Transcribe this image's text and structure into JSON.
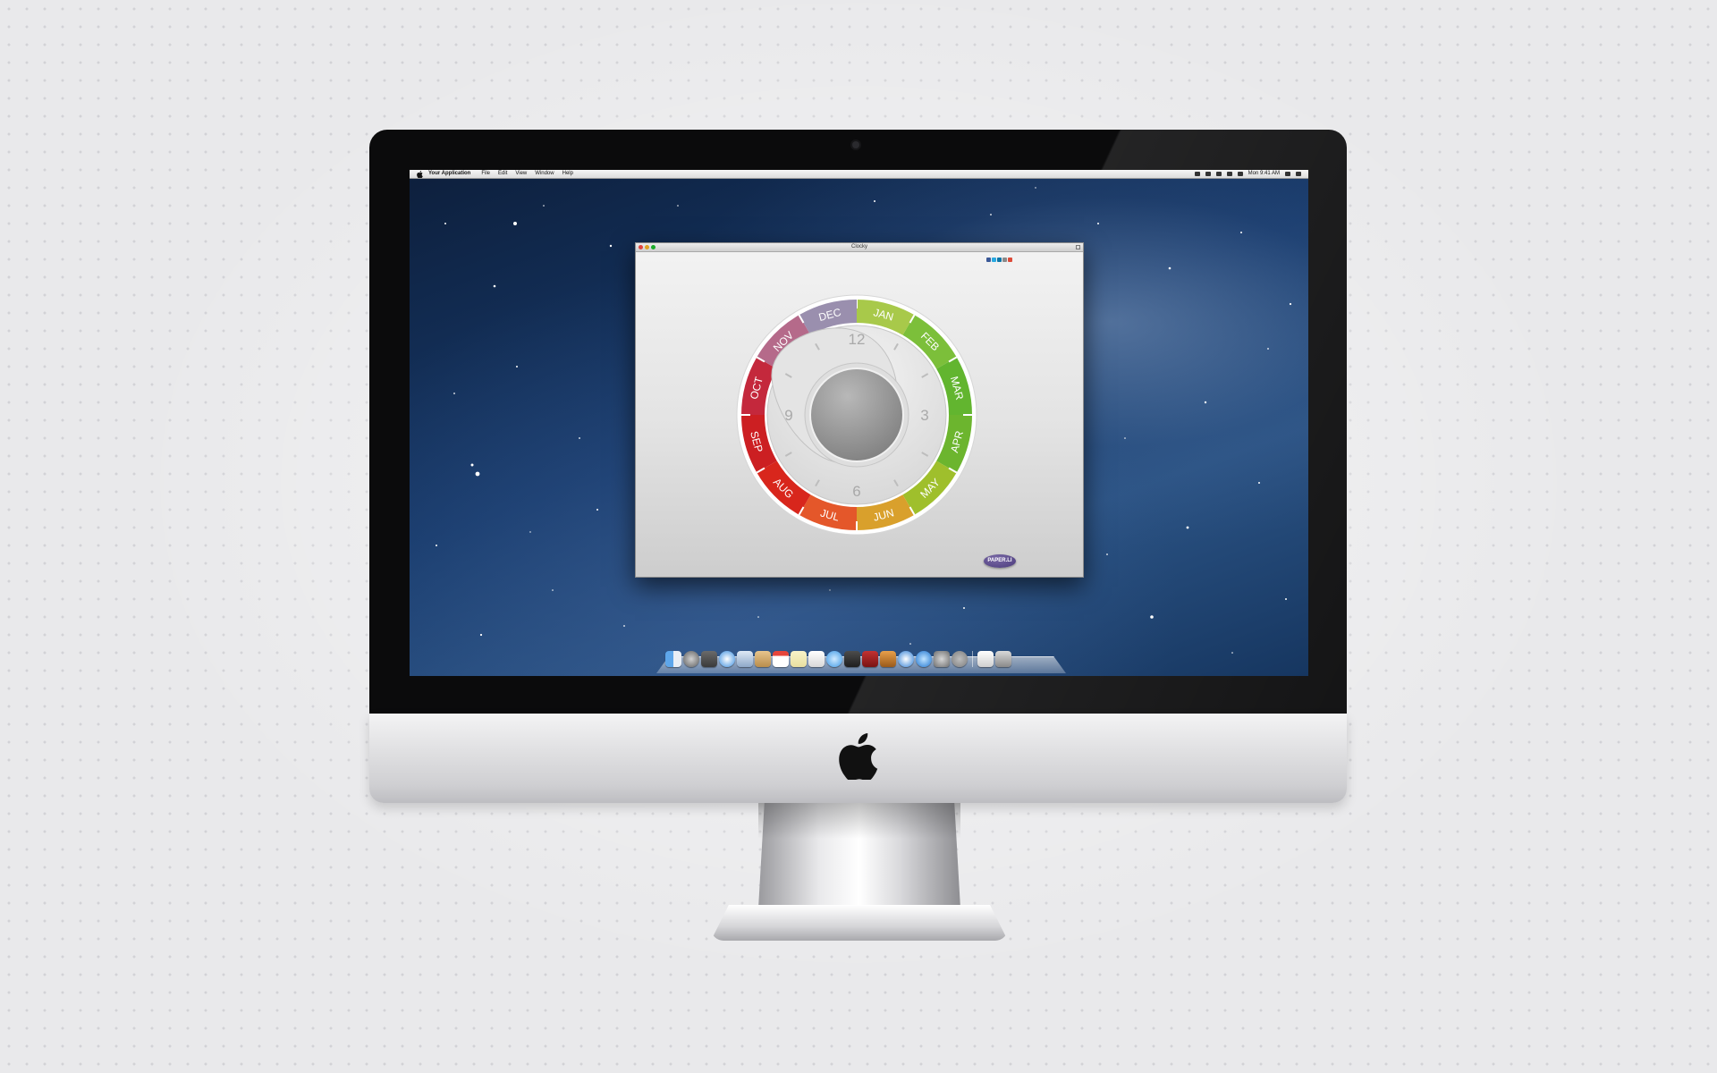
{
  "menubar": {
    "app_name": "Your Application",
    "menus": [
      "File",
      "Edit",
      "View",
      "Window",
      "Help"
    ],
    "clock": "Mon 9:41 AM"
  },
  "window": {
    "title": "Clocky",
    "badge_text": "PAPER.LI"
  },
  "dial": {
    "months": [
      "JAN",
      "FEB",
      "MAR",
      "APR",
      "MAY",
      "JUN",
      "JUL",
      "AUG",
      "SEP",
      "OCT",
      "NOV",
      "DEC"
    ],
    "hours": [
      "12",
      "3",
      "6",
      "9"
    ]
  },
  "colors": {
    "accent_green": "#6dbb2a",
    "accent_red": "#d8261c",
    "window_bg": "#e6e6e6",
    "badge": "#5b4a8f"
  },
  "icons": {
    "share": [
      "facebook-icon",
      "twitter-icon",
      "linkedin-icon",
      "email-icon",
      "googleplus-icon"
    ],
    "dock": [
      "finder-icon",
      "launchpad-icon",
      "mission-control-icon",
      "safari-icon",
      "mail-icon",
      "contacts-icon",
      "calendar-icon",
      "notes-icon",
      "reminders-icon",
      "messages-icon",
      "facetime-icon",
      "photo-booth-icon",
      "iphoto-icon",
      "itunes-icon",
      "app-store-icon",
      "system-preferences-icon",
      "clocky-icon",
      "document-icon",
      "trash-icon"
    ]
  }
}
